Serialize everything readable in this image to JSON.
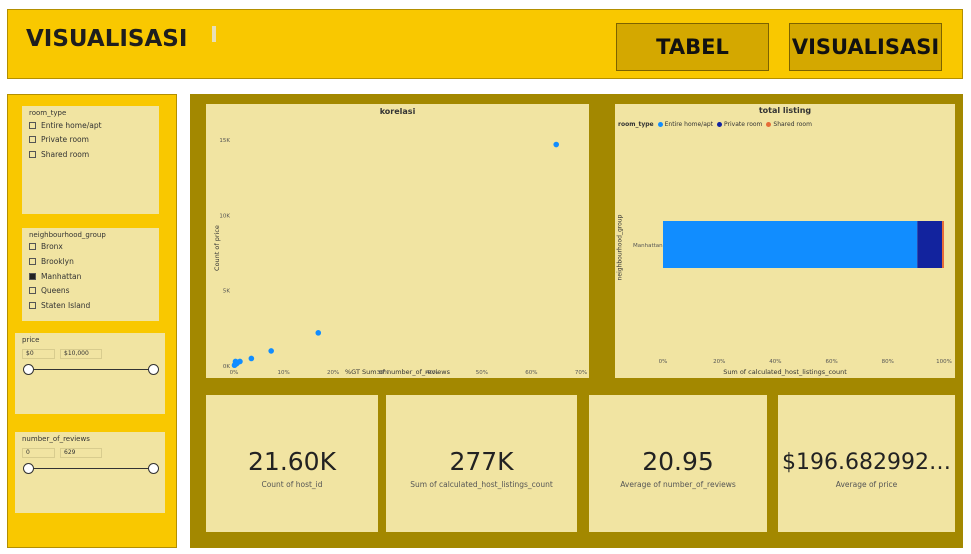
{
  "header": {
    "title": "VISUALISASI",
    "nav": {
      "tabel_label": "TABEL",
      "visualisasi_label": "VISUALISASI"
    }
  },
  "slicers": {
    "room_type": {
      "title": "room_type",
      "items": [
        "Entire home/apt",
        "Private room",
        "Shared room"
      ]
    },
    "neighbourhood_group": {
      "title": "neighbourhood_group",
      "items": [
        "Bronx",
        "Brooklyn",
        "Manhattan",
        "Queens",
        "Staten Island"
      ],
      "selected": "Manhattan"
    },
    "price": {
      "title": "price",
      "min": "$0",
      "max": "$10,000"
    },
    "number_of_reviews": {
      "title": "number_of_reviews",
      "min": "0",
      "max": "629"
    }
  },
  "colors": {
    "accent": "#f9c800",
    "panel": "#f1e4a2",
    "canvas": "#a38800",
    "series_entire": "#118dff",
    "series_private": "#12239e",
    "series_shared": "#e66c37"
  },
  "charts": {
    "korelasi": {
      "title": "korelasi",
      "xlabel": "%GT Sum of number_of_reviews",
      "ylabel": "Count of price",
      "x_ticks": [
        "0%",
        "10%",
        "20%",
        "30%",
        "40%",
        "50%",
        "60%",
        "70%"
      ],
      "y_ticks": [
        "0K",
        "5K",
        "10K",
        "15K"
      ]
    },
    "total_listing": {
      "title": "total listing",
      "legend_title": "room_type",
      "xlabel": "Sum of calculated_host_listings_count",
      "ylabel": "neighbourhood_group",
      "category": "Manhattan",
      "x_ticks": [
        "0%",
        "20%",
        "40%",
        "60%",
        "80%",
        "100%"
      ]
    }
  },
  "chart_data": [
    {
      "type": "scatter",
      "title": "korelasi",
      "xlabel": "%GT Sum of number_of_reviews",
      "ylabel": "Count of price",
      "xlim": [
        0,
        70
      ],
      "ylim": [
        0,
        15000
      ],
      "series": [
        {
          "points": [
            {
              "x": 65.0,
              "y": 14700
            },
            {
              "x": 17.0,
              "y": 2200
            },
            {
              "x": 7.5,
              "y": 1000
            },
            {
              "x": 3.5,
              "y": 500
            },
            {
              "x": 1.2,
              "y": 300
            },
            {
              "x": 0.8,
              "y": 250
            },
            {
              "x": 0.5,
              "y": 150
            },
            {
              "x": 0.3,
              "y": 300
            },
            {
              "x": 0.2,
              "y": 100
            },
            {
              "x": 0.1,
              "y": 50
            }
          ]
        }
      ]
    },
    {
      "type": "bar",
      "stacked": true,
      "orientation": "horizontal",
      "title": "total listing",
      "xlabel": "Sum of calculated_host_listings_count",
      "ylabel": "neighbourhood_group",
      "xlim": [
        0,
        100
      ],
      "categories": [
        "Manhattan"
      ],
      "series": [
        {
          "name": "Entire home/apt",
          "values": [
            90.5
          ]
        },
        {
          "name": "Private room",
          "values": [
            8.8
          ]
        },
        {
          "name": "Shared room",
          "values": [
            0.7
          ]
        }
      ]
    }
  ],
  "kpis": [
    {
      "value": "21.60K",
      "label": "Count of host_id"
    },
    {
      "value": "277K",
      "label": "Sum of calculated_host_listings_count"
    },
    {
      "value": "20.95",
      "label": "Average of number_of_reviews"
    },
    {
      "value": "$196.682992…",
      "label": "Average of price"
    }
  ]
}
